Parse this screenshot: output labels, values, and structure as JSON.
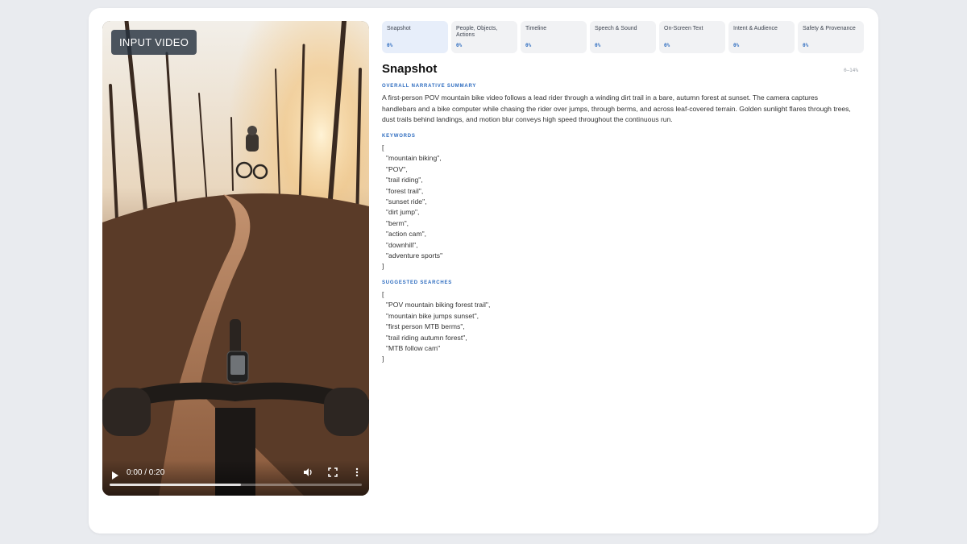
{
  "video": {
    "badge": "INPUT VIDEO",
    "time": "0:00 / 0:20",
    "progress_fraction": 0.52,
    "controls": [
      "play-icon",
      "volume-icon",
      "fullscreen-icon",
      "more-options-icon"
    ]
  },
  "tabs": [
    {
      "label": "Snapshot",
      "pct": "0%",
      "active": true
    },
    {
      "label": "People, Objects, Actions",
      "pct": "0%"
    },
    {
      "label": "Timeline",
      "pct": "0%"
    },
    {
      "label": "Speech & Sound",
      "pct": "0%"
    },
    {
      "label": "On-Screen Text",
      "pct": "0%"
    },
    {
      "label": "Intent & Audience",
      "pct": "0%"
    },
    {
      "label": "Safety & Provenance",
      "pct": "0%"
    }
  ],
  "panel": {
    "title": "Snapshot",
    "range": "0–14%",
    "summary_label": "OVERALL NARRATIVE SUMMARY",
    "summary": "A first-person POV mountain bike video follows a lead rider through a winding dirt trail in a bare, autumn forest at sunset. The camera captures handlebars and a bike computer while chasing the rider over jumps, through berms, and across leaf-covered terrain. Golden sunlight flares through trees, dust trails behind landings, and motion blur conveys high speed throughout the continuous run.",
    "keywords_label": "KEYWORDS",
    "keywords": [
      "\"mountain biking\",",
      "\"POV\",",
      "\"trail riding\",",
      "\"forest trail\",",
      "\"sunset ride\",",
      "\"dirt jump\",",
      "\"berm\",",
      "\"action cam\",",
      "\"downhill\",",
      "\"adventure sports\""
    ],
    "searches_label": "SUGGESTED SEARCHES",
    "searches": [
      "\"POV mountain biking forest trail\",",
      "\"mountain bike jumps sunset\",",
      "\"first person MTB berms\",",
      "\"trail riding autumn forest\",",
      "\"MTB follow cam\""
    ],
    "open_bracket": "[",
    "close_bracket": "]"
  }
}
